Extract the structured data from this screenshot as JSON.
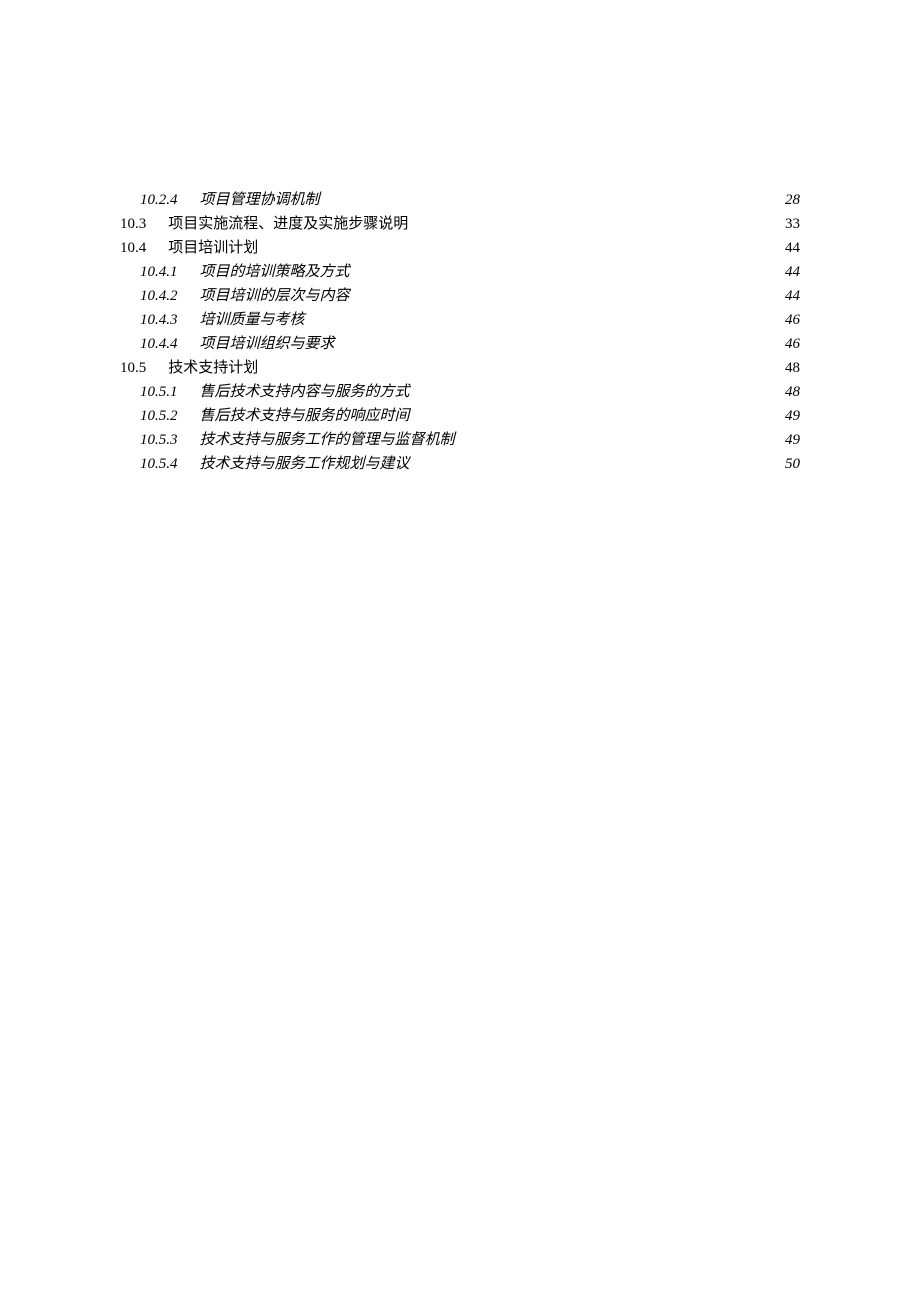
{
  "toc": {
    "entries": [
      {
        "level": 3,
        "num": "10.2.4",
        "title": "项目管理协调机制",
        "page": "28"
      },
      {
        "level": 2,
        "num": "10.3",
        "title": "项目实施流程、进度及实施步骤说明",
        "page": "33"
      },
      {
        "level": 2,
        "num": "10.4",
        "title": "项目培训计划",
        "page": "44"
      },
      {
        "level": 3,
        "num": "10.4.1",
        "title": "项目的培训策略及方式",
        "page": "44"
      },
      {
        "level": 3,
        "num": "10.4.2",
        "title": "项目培训的层次与内容",
        "page": "44"
      },
      {
        "level": 3,
        "num": "10.4.3",
        "title": "培训质量与考核",
        "page": "46"
      },
      {
        "level": 3,
        "num": "10.4.4",
        "title": "项目培训组织与要求",
        "page": "46"
      },
      {
        "level": 2,
        "num": "10.5",
        "title": "技术支持计划",
        "page": "48"
      },
      {
        "level": 3,
        "num": "10.5.1",
        "title": "售后技术支持内容与服务的方式",
        "page": "48"
      },
      {
        "level": 3,
        "num": "10.5.2",
        "title": "售后技术支持与服务的响应时间",
        "page": "49"
      },
      {
        "level": 3,
        "num": "10.5.3",
        "title": "技术支持与服务工作的管理与监督机制",
        "page": "49"
      },
      {
        "level": 3,
        "num": "10.5.4",
        "title": "技术支持与服务工作规划与建议",
        "page": "50"
      }
    ]
  }
}
